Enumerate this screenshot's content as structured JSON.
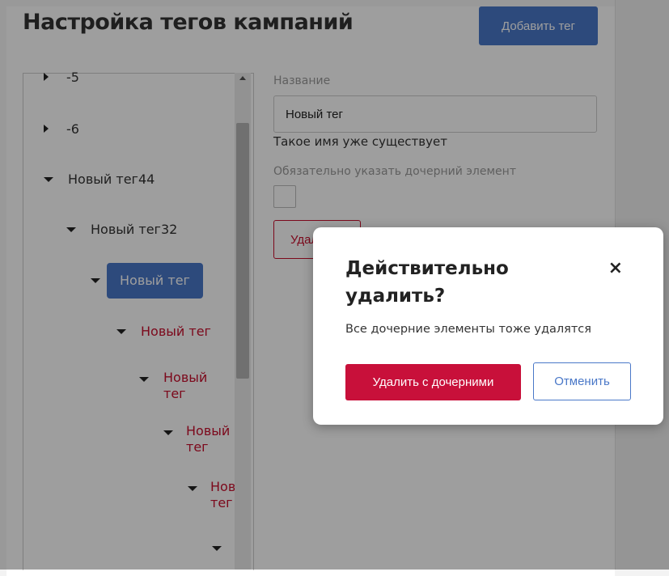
{
  "page": {
    "title": "Настройка тегов кампаний",
    "add_tag_label": "Добавить тег"
  },
  "tree": {
    "nodes": [
      {
        "label": "-5",
        "expanded": false
      },
      {
        "label": "-6",
        "expanded": false
      },
      {
        "label": "Новый тег44",
        "expanded": true
      },
      {
        "label": "Новый тег32",
        "expanded": true
      },
      {
        "label": "Новый тег",
        "expanded": true,
        "selected": true
      },
      {
        "label": "Новый тег",
        "expanded": true
      },
      {
        "label": "Новый тег",
        "expanded": true
      },
      {
        "label": "Новый тег",
        "expanded": true
      },
      {
        "label": "Новый тег",
        "expanded": true
      },
      {
        "label": "",
        "expanded": true
      }
    ]
  },
  "form": {
    "name_label": "Название",
    "name_value": "Новый тег",
    "error": "Такое имя уже существует",
    "child_required_label": "Обязательно указать дочерний элемент",
    "delete_label": "Удалить"
  },
  "modal": {
    "title": "Действительно удалить?",
    "text": "Все дочерние элементы тоже удалятся",
    "confirm_label": "Удалить с дочерними",
    "cancel_label": "Отменить",
    "close_glyph": "×"
  },
  "colors": {
    "accent_blue": "#4a78c8",
    "danger_red": "#c8103a"
  }
}
